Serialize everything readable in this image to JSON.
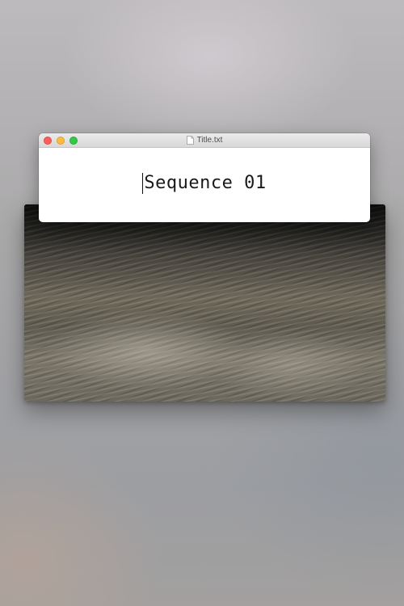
{
  "media_window": {
    "content": "water-surface-video"
  },
  "editor": {
    "window_title": "Title.txt",
    "document_icon": "text-document-icon",
    "text": "Sequence 01",
    "traffic_lights": {
      "close_color": "#fc605b",
      "minimize_color": "#fdbc40",
      "zoom_color": "#34c84a"
    }
  }
}
